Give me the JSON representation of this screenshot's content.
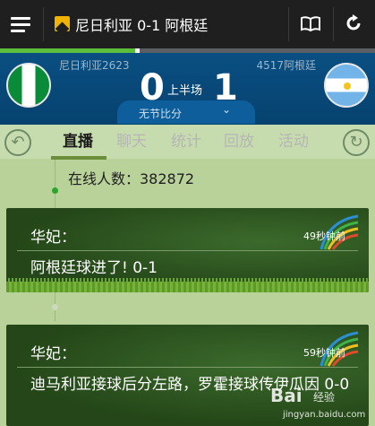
{
  "header": {
    "title": "尼日利亚 0-1 阿根廷",
    "icons": {
      "menu": "menu-icon",
      "app": "app-logo-icon",
      "book": "book-icon",
      "refresh": "refresh-icon"
    }
  },
  "match_progress": 0.36,
  "match": {
    "home": {
      "name": "尼日利亚2623",
      "goals": "0",
      "flag": "nigeria-flag"
    },
    "away": {
      "name": "4517阿根廷",
      "goals": "1",
      "flag": "argentina-flag"
    },
    "period": "上半场",
    "halftime_label": "无节比分",
    "chevron": "⌄"
  },
  "tabs": [
    {
      "label": "直播",
      "active": true
    },
    {
      "label": "聊天",
      "active": false
    },
    {
      "label": "统计",
      "active": false
    },
    {
      "label": "回放",
      "active": false
    },
    {
      "label": "活动",
      "active": false
    }
  ],
  "online": {
    "text": "在线人数：382872"
  },
  "feed": [
    {
      "author": "华妃：",
      "time": "49秒钟前",
      "text": "阿根廷球进了! 0-1"
    },
    {
      "author": "华妃：",
      "time": "59秒钟前",
      "text": "迪马利亚接球后分左路，罗霍接球传伊瓜因 0-0"
    }
  ],
  "watermark": {
    "brand": "Bai",
    "sub": "经验",
    "url": "jingyan.baidu.com"
  },
  "colors": {
    "accent": "#5bbf3a",
    "score_bg": "#0a4f82",
    "page_bg": "#b9d29a"
  }
}
